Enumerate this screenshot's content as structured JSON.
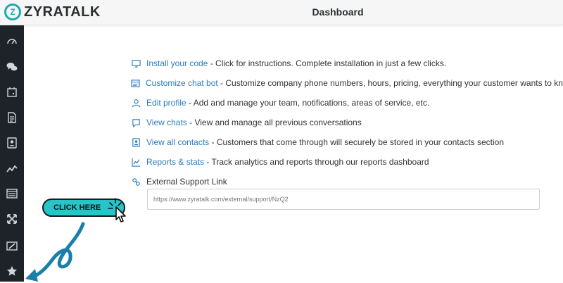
{
  "app": {
    "brand": "ZYRATALK",
    "brand_mark": "Z",
    "title": "Dashboard"
  },
  "colors": {
    "accent": "#1fa9b3",
    "link": "#2b7bbd",
    "sidebar_bg": "#1e2329",
    "cta": "#27c4c8",
    "arrow": "#1a7fa8"
  },
  "sidebar": {
    "items": [
      {
        "icon": "speedometer-icon"
      },
      {
        "icon": "chat-bubbles-icon"
      },
      {
        "icon": "calendar-icon"
      },
      {
        "icon": "document-icon"
      },
      {
        "icon": "contact-card-icon"
      },
      {
        "icon": "trend-line-icon"
      },
      {
        "icon": "list-window-icon"
      },
      {
        "icon": "expand-arrows-icon"
      },
      {
        "icon": "window-edit-icon"
      },
      {
        "icon": "star-icon"
      }
    ]
  },
  "links": [
    {
      "icon": "monitor-icon",
      "label": "Install your code",
      "desc": " - Click for instructions. Complete installation in just a few clicks."
    },
    {
      "icon": "chatbot-card-icon",
      "label": "Customize chat bot",
      "desc": " - Customize company phone numbers, hours, pricing, everything your customer wants to know"
    },
    {
      "icon": "user-icon",
      "label": "Edit profile",
      "desc": " - Add and manage your team, notifications, areas of service, etc."
    },
    {
      "icon": "chat-window-icon",
      "label": "View chats",
      "desc": " - View and manage all previous conversations"
    },
    {
      "icon": "contact-book-icon",
      "label": "View all contacts",
      "desc": " - Customers that come through will securely be stored in your contacts section"
    },
    {
      "icon": "chart-icon",
      "label": "Reports & stats",
      "desc": " - Track analytics and reports through our reports dashboard"
    }
  ],
  "external": {
    "icon": "link-icon",
    "label": "External Support Link",
    "value": "https://www.zyratalk.com/external/support/NzQ2"
  },
  "cta": {
    "label": "CLICK HERE"
  }
}
